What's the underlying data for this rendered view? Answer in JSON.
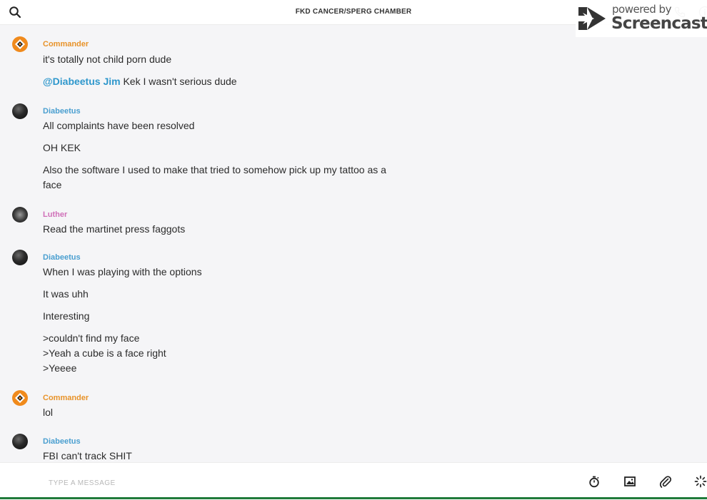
{
  "header": {
    "title": "FKD CANCER/SPERG CHAMBER"
  },
  "watermark": {
    "top_text": "powered by",
    "brand_text": "Screencastify"
  },
  "messages": [
    {
      "author": "Commander",
      "lines": [
        "it's totally not child porn dude"
      ],
      "mention_line": {
        "mention": "@Diabeetus Jim",
        "text": " Kek I wasn't serious dude"
      }
    },
    {
      "author": "Diabeetus",
      "lines": [
        "All complaints have been resolved",
        "OH KEK",
        "Also the software I used to make that tried to somehow pick up my tattoo as a",
        "face"
      ]
    },
    {
      "author": "Luther",
      "lines": [
        "Read the martinet press faggots"
      ]
    },
    {
      "author": "Diabeetus",
      "lines": [
        "When I was playing with the options",
        "It was uhh",
        "Interesting",
        ">couldn't find my face",
        ">Yeah a cube is a face right",
        ">Yeeee"
      ]
    },
    {
      "author": "Commander",
      "lines": [
        "lol"
      ]
    },
    {
      "author": "Diabeetus",
      "lines": [
        "FBI can't track SHIT"
      ]
    }
  ],
  "composer": {
    "placeholder": "TYPE A MESSAGE"
  },
  "colors": {
    "commander": "#e8932a",
    "diabeetus": "#4a9fd0",
    "luther": "#d070b8",
    "mention": "#2e97cc"
  },
  "icons": [
    "search-icon",
    "phone-icon",
    "info-icon",
    "timer-icon",
    "image-icon",
    "paperclip-icon",
    "loading-icon"
  ]
}
